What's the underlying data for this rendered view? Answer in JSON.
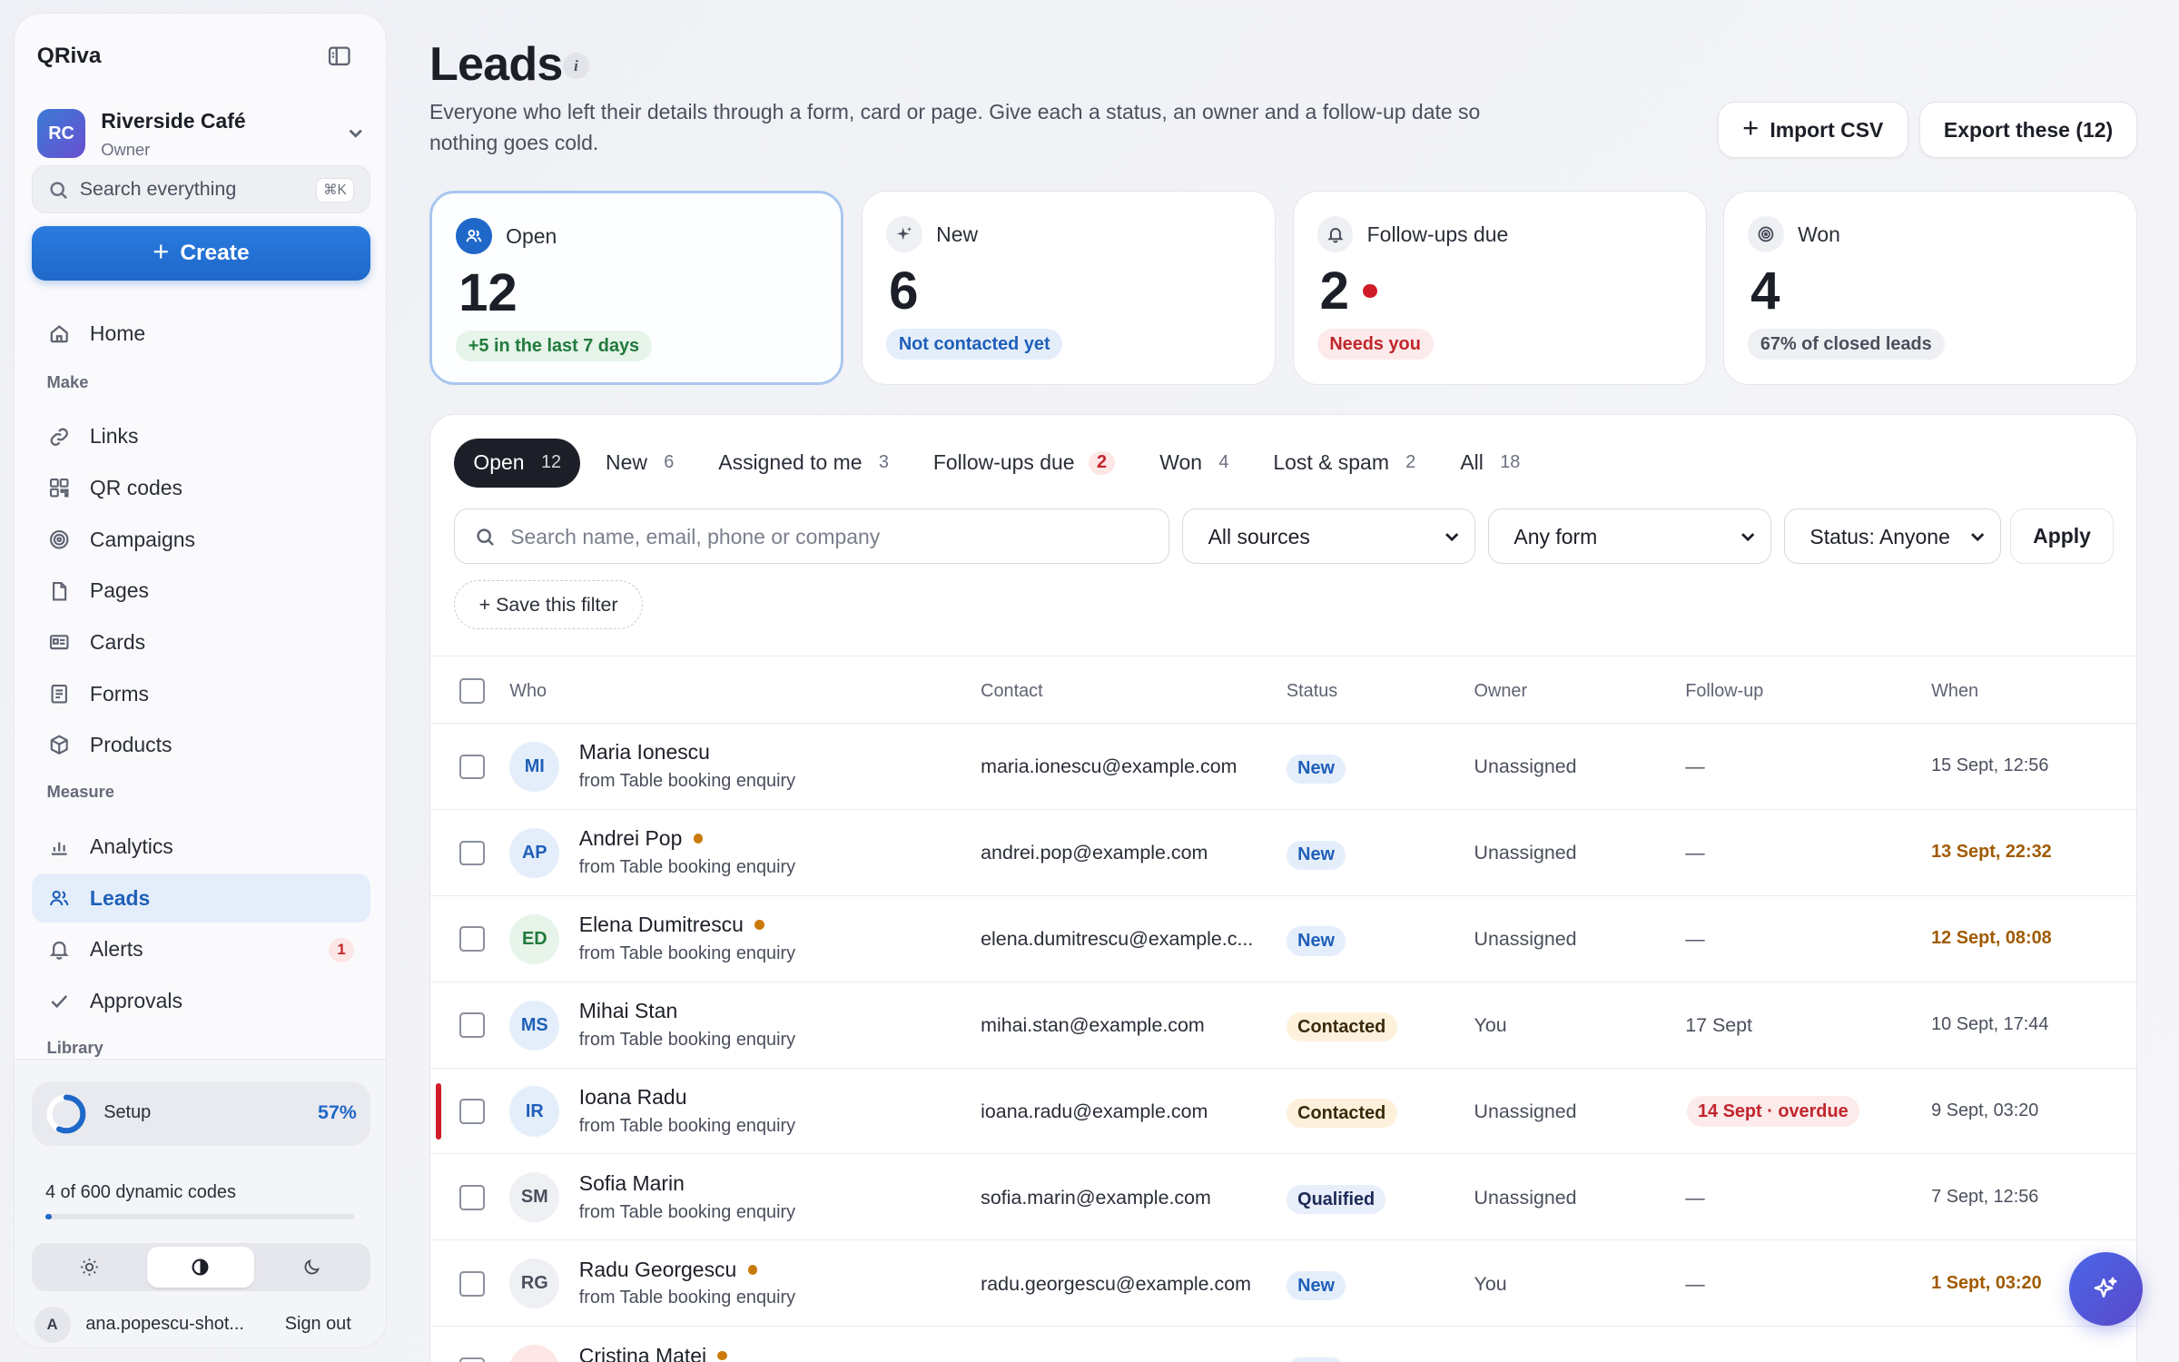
{
  "sidebar": {
    "brand": "QRiva",
    "workspace": {
      "initials": "RC",
      "name": "Riverside Café",
      "role": "Owner"
    },
    "search": {
      "placeholder": "Search everything",
      "shortcut": "⌘K"
    },
    "create_label": "Create",
    "home_label": "Home",
    "sections": {
      "make": "Make",
      "measure": "Measure",
      "library": "Library"
    },
    "make_items": [
      {
        "label": "Links",
        "icon": "link-icon"
      },
      {
        "label": "QR codes",
        "icon": "qr-code-icon"
      },
      {
        "label": "Campaigns",
        "icon": "target-icon"
      },
      {
        "label": "Pages",
        "icon": "page-icon"
      },
      {
        "label": "Cards",
        "icon": "id-card-icon"
      },
      {
        "label": "Forms",
        "icon": "form-icon"
      },
      {
        "label": "Products",
        "icon": "box-icon"
      }
    ],
    "measure_items": [
      {
        "label": "Analytics",
        "icon": "bar-chart-icon"
      },
      {
        "label": "Leads",
        "icon": "users-icon",
        "active": true
      },
      {
        "label": "Alerts",
        "icon": "bell-icon",
        "badge": "1"
      },
      {
        "label": "Approvals",
        "icon": "check-icon"
      }
    ],
    "setup": {
      "label": "Setup",
      "percent_label": "57%",
      "progress": 0.57
    },
    "quota": {
      "label": "4 of 600 dynamic codes",
      "used": 4,
      "total": 600
    },
    "theme_options": [
      "light",
      "auto",
      "dark"
    ],
    "theme_selected": "auto",
    "user": {
      "initial": "A",
      "email": "ana.popescu-shot...",
      "sign_out": "Sign out"
    }
  },
  "header": {
    "title": "Leads",
    "description": "Everyone who left their details through a form, card or page. Give each a status, an owner and a follow-up date so nothing goes cold.",
    "import_label": "Import CSV",
    "export_label": "Export these (12)"
  },
  "stats": [
    {
      "label": "Open",
      "value": "12",
      "note": "+5 in the last 7 days",
      "tone": "green",
      "selected": true
    },
    {
      "label": "New",
      "value": "6",
      "note": "Not contacted yet",
      "tone": "blue"
    },
    {
      "label": "Follow-ups due",
      "value": "2",
      "note": "Needs you",
      "tone": "red",
      "alert": true
    },
    {
      "label": "Won",
      "value": "4",
      "note": "67% of closed leads",
      "tone": "grey"
    }
  ],
  "tabs": [
    {
      "label": "Open",
      "count": "12",
      "active": true
    },
    {
      "label": "New",
      "count": "6"
    },
    {
      "label": "Assigned to me",
      "count": "3"
    },
    {
      "label": "Follow-ups due",
      "count": "2",
      "highlight": true
    },
    {
      "label": "Won",
      "count": "4"
    },
    {
      "label": "Lost & spam",
      "count": "2"
    },
    {
      "label": "All",
      "count": "18"
    }
  ],
  "filters": {
    "search_placeholder": "Search name, email, phone or company",
    "source": "All sources",
    "form": "Any form",
    "status": "Status: Anyone",
    "apply_label": "Apply",
    "save_label": "+ Save this filter"
  },
  "table": {
    "columns": [
      "Who",
      "Contact",
      "Status",
      "Owner",
      "Follow-up",
      "When"
    ],
    "rows": [
      {
        "initials": "MI",
        "avatar": "blue",
        "name": "Maria Ionescu",
        "dot": false,
        "source": "from Table booking enquiry",
        "contact": "maria.ionescu@example.com",
        "status": "New",
        "owner": "Unassigned",
        "followup": "—",
        "when": "15 Sept, 12:56",
        "warn": false
      },
      {
        "initials": "AP",
        "avatar": "blue",
        "name": "Andrei Pop",
        "dot": true,
        "source": "from Table booking enquiry",
        "contact": "andrei.pop@example.com",
        "status": "New",
        "owner": "Unassigned",
        "followup": "—",
        "when": "13 Sept, 22:32",
        "warn": true
      },
      {
        "initials": "ED",
        "avatar": "green",
        "name": "Elena Dumitrescu",
        "dot": true,
        "source": "from Table booking enquiry",
        "contact": "elena.dumitrescu@example.c...",
        "status": "New",
        "owner": "Unassigned",
        "followup": "—",
        "when": "12 Sept, 08:08",
        "warn": true
      },
      {
        "initials": "MS",
        "avatar": "blue",
        "name": "Mihai Stan",
        "dot": false,
        "source": "from Table booking enquiry",
        "contact": "mihai.stan@example.com",
        "status": "Contacted",
        "owner": "You",
        "followup": "17 Sept",
        "when": "10 Sept, 17:44",
        "warn": false
      },
      {
        "initials": "IR",
        "avatar": "blue",
        "name": "Ioana Radu",
        "dot": false,
        "source": "from Table booking enquiry",
        "contact": "ioana.radu@example.com",
        "status": "Contacted",
        "owner": "Unassigned",
        "followup": "14 Sept · overdue",
        "overdue": true,
        "when": "9 Sept, 03:20",
        "warn": false
      },
      {
        "initials": "SM",
        "avatar": "grey",
        "name": "Sofia Marin",
        "dot": false,
        "source": "from Table booking enquiry",
        "contact": "sofia.marin@example.com",
        "status": "Qualified",
        "owner": "Unassigned",
        "followup": "—",
        "when": "7 Sept, 12:56",
        "warn": false
      },
      {
        "initials": "RG",
        "avatar": "grey",
        "name": "Radu Georgescu",
        "dot": true,
        "source": "from Table booking enquiry",
        "contact": "radu.georgescu@example.com",
        "status": "New",
        "owner": "You",
        "followup": "—",
        "when": "1 Sept, 03:20",
        "warn": true
      },
      {
        "initials": "CM",
        "avatar": "pink",
        "name": "Cristina Matei",
        "dot": true,
        "source": "",
        "contact": "",
        "status": "New",
        "owner": "",
        "followup": "",
        "when": "",
        "warn": false
      }
    ]
  },
  "assistant": {
    "icon": "sparkle-icon"
  },
  "colors": {
    "accent": "#1f68c9",
    "danger": "#d01c28",
    "warning": "#a05a00",
    "ink": "#1c1f27"
  }
}
